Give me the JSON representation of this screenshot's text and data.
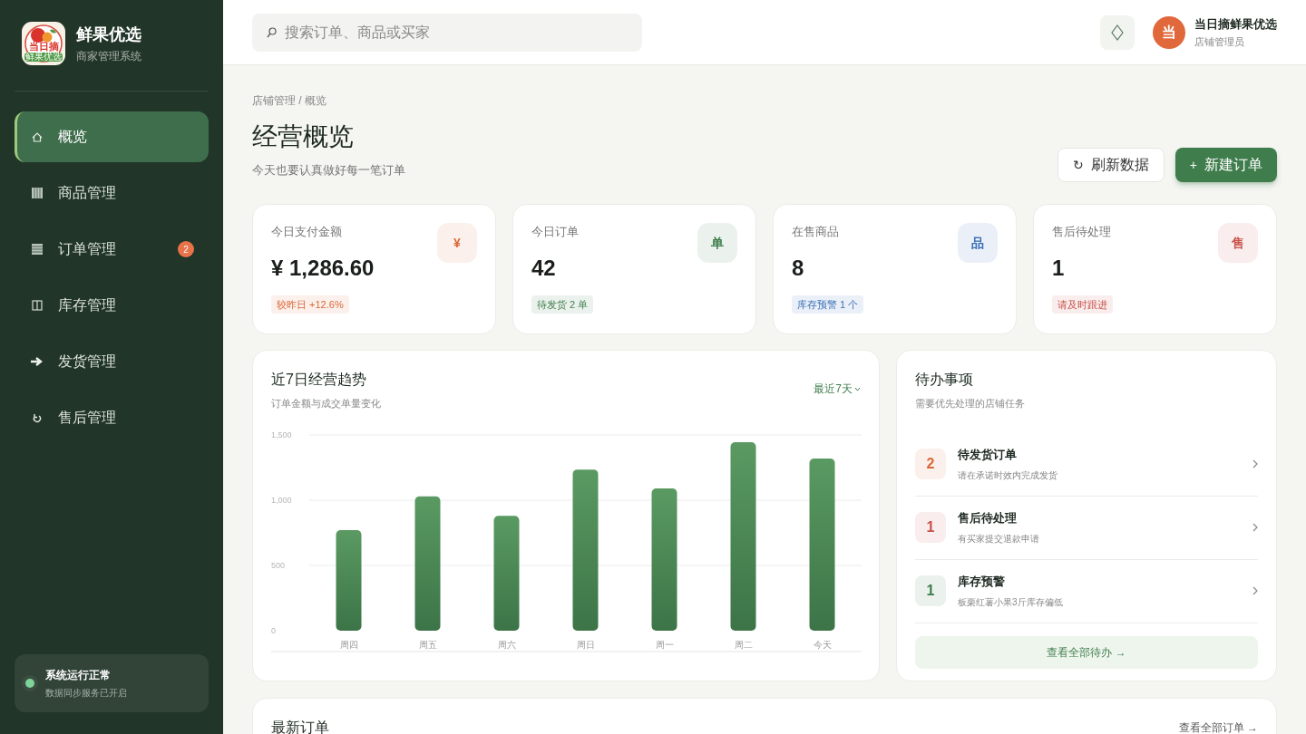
{
  "brand": {
    "logo_text": [
      "当日摘",
      "鲜果优选"
    ],
    "title": "鲜果优选",
    "subtitle": "商家管理系统"
  },
  "nav": [
    {
      "kind": "home",
      "label": "概览",
      "selected": true
    },
    {
      "kind": "grid",
      "label": "商品管理",
      "selected": false
    },
    {
      "kind": "list",
      "label": "订单管理",
      "selected": false,
      "badge": "2"
    },
    {
      "kind": "columns",
      "label": "库存管理",
      "selected": false
    },
    {
      "kind": "arrow",
      "label": "发货管理",
      "selected": false
    },
    {
      "kind": "refresh",
      "label": "售后管理",
      "selected": false
    }
  ],
  "system_status": {
    "title": "系统运行正常",
    "detail": "数据同步服务已开启",
    "color": "#7fd49a"
  },
  "header": {
    "search": {
      "placeholder": "搜索订单、商品或买家"
    },
    "avatar": "当",
    "user_name": "当日摘鲜果优选",
    "user_role": "店铺管理员"
  },
  "breadcrumb": "店铺管理 / 概览",
  "page_title": "经营概览",
  "page_subtitle": "今天也要认真做好每一笔订单",
  "actions": [
    {
      "kind": "secondary",
      "icon": "↻",
      "label": "刷新数据"
    },
    {
      "kind": "primary",
      "icon": "+",
      "label": "新建订单"
    }
  ],
  "stats": [
    {
      "label": "今日支付金额",
      "value": "¥ 1,286.60",
      "icon": "¥",
      "color": "#d9693a",
      "note": "较昨日 +12.6%"
    },
    {
      "label": "今日订单",
      "value": "42",
      "icon": "单",
      "color": "#3f7d4c",
      "note": "待发货 2 单"
    },
    {
      "label": "在售商品",
      "value": "8",
      "icon": "品",
      "color": "#3b6fb6",
      "note": "库存预警 1 个"
    },
    {
      "label": "售后待处理",
      "value": "1",
      "icon": "售",
      "color": "#c9534a",
      "note": "请及时跟进"
    }
  ],
  "trend": {
    "title": "近7日经营趋势",
    "subtitle": "订单金额与成交单量变化",
    "range": "最近7天",
    "chart_data": {
      "type": "bar",
      "categories": [
        "周四",
        "周五",
        "周六",
        "周日",
        "周一",
        "周二",
        "今天"
      ],
      "values": [
        770,
        1030,
        880,
        1235,
        1090,
        1445,
        1320
      ],
      "ylim": [
        0,
        1500
      ],
      "yticks": [
        0,
        {
          "value": 500,
          "label": "500"
        },
        {
          "value": 1000,
          "label": "1,000"
        },
        {
          "value": 1500,
          "label": "1,500"
        }
      ]
    }
  },
  "todo": {
    "title": "待办事项",
    "subtitle": "需要优先处理的店铺任务",
    "items": [
      {
        "count": "2",
        "color": "#d9693a",
        "title": "待发货订单",
        "detail": "请在承诺时效内完成发货"
      },
      {
        "count": "1",
        "color": "#c9534a",
        "title": "售后待处理",
        "detail": "有买家提交退款申请"
      },
      {
        "count": "1",
        "color": "#3f7d4c",
        "title": "库存预警",
        "detail": "板栗红薯小果3斤库存偏低"
      }
    ],
    "more": "查看全部待办 →"
  },
  "recent_orders": {
    "title": "最新订单",
    "more": "查看全部订单 →"
  }
}
